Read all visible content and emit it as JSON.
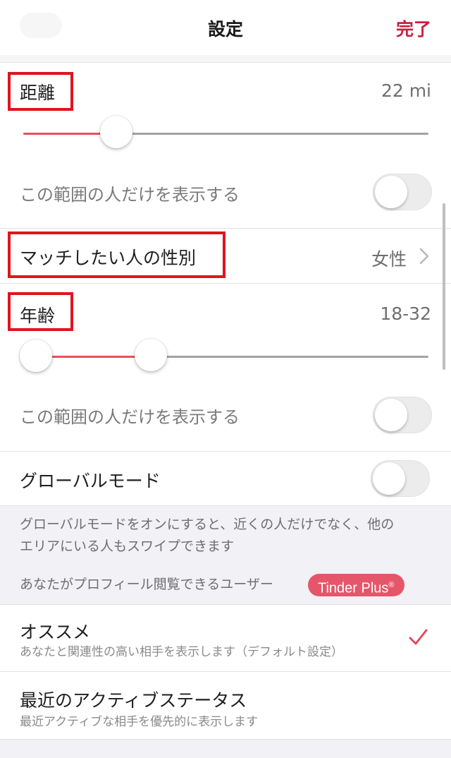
{
  "nav": {
    "title": "設定",
    "done_label": "完了"
  },
  "distance": {
    "label": "距離",
    "value": "22 mi",
    "slider_fraction": 0.2
  },
  "distance_only_range": {
    "label": "この範囲の人だけを表示する",
    "on": false
  },
  "gender": {
    "label": "マッチしたい人の性別",
    "value": "女性",
    "chevron_icon": "chevron-right-icon"
  },
  "age": {
    "label": "年齢",
    "value": "18-32",
    "min": 18,
    "max": 32
  },
  "age_only_range": {
    "label": "この範囲の人だけを表示する",
    "on": false
  },
  "global_mode": {
    "label": "グローバルモード",
    "on": false,
    "description_line1": "グローバルモードをオンにすると、近くの人だけでなく、他の",
    "description_line2": "エリアにいる人もスワイプできます"
  },
  "profile_viewers": {
    "section_label": "あなたがプロフィール閲覧できるユーザー",
    "badge_label": "Tinder Plus",
    "badge_mark": "®"
  },
  "options": [
    {
      "title": "オススメ",
      "subtitle": "あなたと関連性の高い相手を表示します（デフォルト設定）",
      "selected": true
    },
    {
      "title": "最近のアクティブステータス",
      "subtitle": "最近アクティブな相手を優先的に表示します",
      "selected": false
    }
  ],
  "colors": {
    "accent": "#c8213f",
    "slider_active": "#e8505b",
    "badge": "#e5566a",
    "highlight_box": "#e0141e",
    "checkmark": "#e24a5c"
  },
  "icons": {
    "check": "checkmark-icon",
    "chevron": "chevron-right-icon"
  }
}
